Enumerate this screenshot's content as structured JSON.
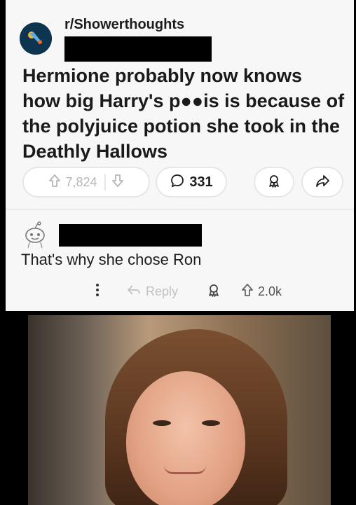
{
  "post": {
    "subreddit": "r/Showerthoughts",
    "title": "Hermione probably now knows how big Harry's p●●is is because of the polyjuice potion she took in the Deathly Hallows",
    "upvotes": "7,824",
    "comments": "331"
  },
  "comment": {
    "body": "That's why she chose Ron",
    "reply_label": "Reply",
    "score": "2.0k"
  },
  "icons": {
    "subreddit": "subreddit-icon",
    "upvote": "arrow-up-icon",
    "downvote": "arrow-down-icon",
    "comment": "speech-bubble-icon",
    "award": "award-icon",
    "share": "share-icon",
    "more": "vertical-dots-icon",
    "reply": "reply-arrow-icon",
    "avatar": "snoo-avatar-icon"
  }
}
